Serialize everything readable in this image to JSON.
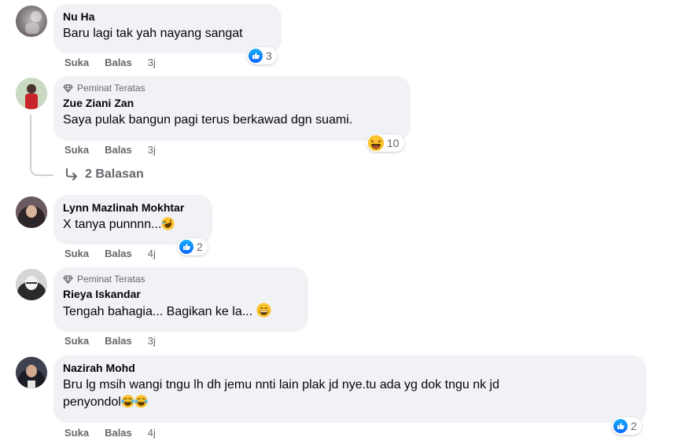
{
  "actions": {
    "like": "Suka",
    "reply": "Balas"
  },
  "badge_label": "Peminat Teratas",
  "comments": [
    {
      "name": "Nu Ha",
      "text": "Baru lagi tak yah nayang sangat",
      "time": "3j",
      "reaction_count": "3",
      "reaction_icon": "like-icon"
    },
    {
      "name": "Zue Ziani Zan",
      "text": "Saya pulak bangun pagi terus berkawad dgn suami.",
      "time": "3j",
      "reaction_count": "10",
      "reaction_icon": "haha-icon",
      "top_fan": true
    },
    {
      "name": "Lynn Mazlinah Mokhtar",
      "text": "X tanya punnnn...",
      "time": "4j",
      "reaction_count": "2",
      "reaction_icon": "like-icon"
    },
    {
      "name": "Rieya Iskandar",
      "text": "Tengah bahagia... Bagikan ke la... ",
      "time": "3j",
      "top_fan": true
    },
    {
      "name": "Nazirah Mohd",
      "text_line1": "Bru lg msih wangi tngu lh dh jemu nnti lain plak jd nye.tu ada yg dok tngu nk jd",
      "text_line2": "penyondol",
      "time": "4j",
      "reaction_count": "2",
      "reaction_icon": "like-icon"
    }
  ],
  "replies_link": "2 Balasan",
  "colors": {
    "bubble": "#f0f2f5",
    "meta": "#65676b",
    "like_blue": "#0866ff",
    "emoji_yellow": "#fcc12b"
  }
}
